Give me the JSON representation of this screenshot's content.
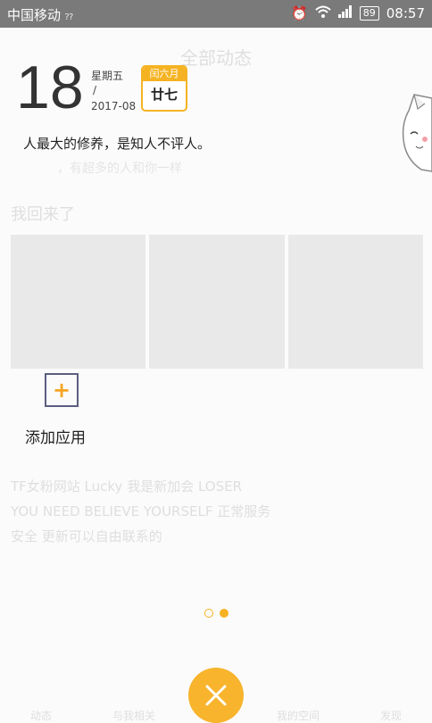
{
  "status_bar": {
    "carrier": "中国移动",
    "battery": "89",
    "time": "08:57"
  },
  "background": {
    "title": "全部动态",
    "row_text": "，有超多的人和你一样",
    "headline": "我回来了",
    "post_lines": [
      "TF女粉网站 Lucky 我是新加会 LOSER",
      "YOU NEED BELIEVE YOURSELF 正常服务",
      "安全 更新可以自由联系的"
    ],
    "nav": [
      "动态",
      "与我相关",
      "",
      "我的空间",
      "发现"
    ]
  },
  "date_widget": {
    "day": "18",
    "weekday": "星期五",
    "slash": "/",
    "year_month": "2017-08",
    "lunar_month": "闰六月",
    "lunar_day": "廿七"
  },
  "quote": "人最大的修养，是知人不评人。",
  "add_app": {
    "icon": "plus-icon",
    "label": "添加应用"
  },
  "pager": {
    "pages": 2,
    "current": 2
  },
  "colors": {
    "accent": "#f5b323",
    "close_button": "#f7b42c",
    "add_border": "#5c5e80"
  }
}
